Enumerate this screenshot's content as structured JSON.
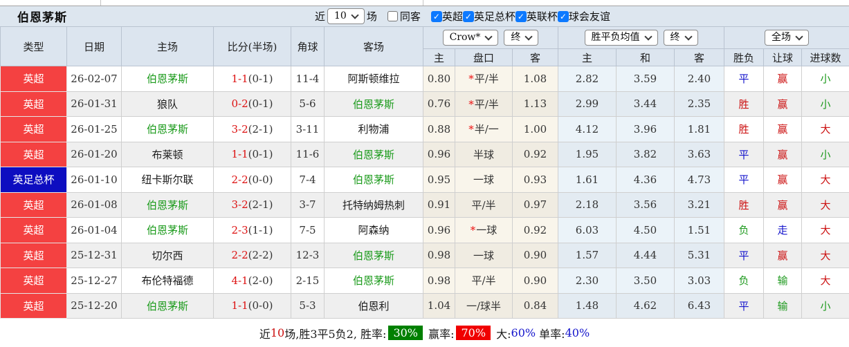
{
  "title": "伯恩茅斯",
  "filter_bar": {
    "recent_label": "近",
    "recent_select": "10",
    "matches_label": "场",
    "same_away_label": "同客",
    "leagues": [
      {
        "label": "英超",
        "checked": true
      },
      {
        "label": "英足总杯",
        "checked": true
      },
      {
        "label": "英联杯",
        "checked": true
      },
      {
        "label": "球会友谊",
        "checked": true
      }
    ]
  },
  "selectors": {
    "crow": "Crow*",
    "crow_state": "终",
    "avg": "胜平负均值",
    "avg_state": "终",
    "scope": "全场"
  },
  "columns": {
    "main": [
      "类型",
      "日期",
      "主场",
      "比分(半场)",
      "角球",
      "客场"
    ],
    "sub": [
      "主",
      "盘口",
      "客",
      "主",
      "和",
      "客",
      "胜负",
      "让球",
      "进球数"
    ]
  },
  "rows": [
    {
      "type": "英超",
      "type_color": "red",
      "date": "26-02-07",
      "home": "伯恩茅斯",
      "home_hl": true,
      "score": "1-1",
      "half": "(0-1)",
      "corner": "11-4",
      "away": "阿斯顿维拉",
      "away_hl": false,
      "crow_home": "0.80",
      "star": true,
      "handicap": "平/半",
      "crow_away": "1.08",
      "avg_home": "2.82",
      "avg_draw": "3.59",
      "avg_away": "2.40",
      "result": "平",
      "result_c": "blue",
      "let": "赢",
      "let_c": "red",
      "goal": "小",
      "goal_c": "green"
    },
    {
      "type": "英超",
      "type_color": "red",
      "date": "26-01-31",
      "home": "狼队",
      "home_hl": false,
      "score": "0-2",
      "half": "(0-1)",
      "corner": "5-6",
      "away": "伯恩茅斯",
      "away_hl": true,
      "crow_home": "0.76",
      "star": true,
      "handicap": "平/半",
      "crow_away": "1.13",
      "avg_home": "2.99",
      "avg_draw": "3.44",
      "avg_away": "2.35",
      "result": "胜",
      "result_c": "red",
      "let": "赢",
      "let_c": "red",
      "goal": "小",
      "goal_c": "green"
    },
    {
      "type": "英超",
      "type_color": "red",
      "date": "26-01-25",
      "home": "伯恩茅斯",
      "home_hl": true,
      "score": "3-2",
      "half": "(2-1)",
      "corner": "3-11",
      "away": "利物浦",
      "away_hl": false,
      "crow_home": "0.88",
      "star": true,
      "handicap": "半/一",
      "crow_away": "1.00",
      "avg_home": "4.12",
      "avg_draw": "3.96",
      "avg_away": "1.81",
      "result": "胜",
      "result_c": "red",
      "let": "赢",
      "let_c": "red",
      "goal": "大",
      "goal_c": "red"
    },
    {
      "type": "英超",
      "type_color": "red",
      "date": "26-01-20",
      "home": "布莱顿",
      "home_hl": false,
      "score": "1-1",
      "half": "(0-1)",
      "corner": "11-6",
      "away": "伯恩茅斯",
      "away_hl": true,
      "crow_home": "0.96",
      "star": false,
      "handicap": "半球",
      "crow_away": "0.92",
      "avg_home": "1.95",
      "avg_draw": "3.82",
      "avg_away": "3.63",
      "result": "平",
      "result_c": "blue",
      "let": "赢",
      "let_c": "red",
      "goal": "小",
      "goal_c": "green"
    },
    {
      "type": "英足总杯",
      "type_color": "blue",
      "date": "26-01-10",
      "home": "纽卡斯尔联",
      "home_hl": false,
      "score": "2-2",
      "half": "(0-0)",
      "corner": "7-4",
      "away": "伯恩茅斯",
      "away_hl": true,
      "crow_home": "0.95",
      "star": false,
      "handicap": "一球",
      "crow_away": "0.93",
      "avg_home": "1.61",
      "avg_draw": "4.36",
      "avg_away": "4.73",
      "result": "平",
      "result_c": "blue",
      "let": "赢",
      "let_c": "red",
      "goal": "大",
      "goal_c": "red"
    },
    {
      "type": "英超",
      "type_color": "red",
      "date": "26-01-08",
      "home": "伯恩茅斯",
      "home_hl": true,
      "score": "3-2",
      "half": "(2-1)",
      "corner": "3-7",
      "away": "托特纳姆热刺",
      "away_hl": false,
      "crow_home": "0.91",
      "star": false,
      "handicap": "平/半",
      "crow_away": "0.97",
      "avg_home": "2.18",
      "avg_draw": "3.56",
      "avg_away": "3.21",
      "result": "胜",
      "result_c": "red",
      "let": "赢",
      "let_c": "red",
      "goal": "大",
      "goal_c": "red"
    },
    {
      "type": "英超",
      "type_color": "red",
      "date": "26-01-04",
      "home": "伯恩茅斯",
      "home_hl": true,
      "score": "2-3",
      "half": "(1-1)",
      "corner": "7-5",
      "away": "阿森纳",
      "away_hl": false,
      "crow_home": "0.96",
      "star": true,
      "handicap": "一球",
      "crow_away": "0.92",
      "avg_home": "6.03",
      "avg_draw": "4.50",
      "avg_away": "1.51",
      "result": "负",
      "result_c": "green",
      "let": "走",
      "let_c": "blue",
      "goal": "大",
      "goal_c": "red"
    },
    {
      "type": "英超",
      "type_color": "red",
      "date": "25-12-31",
      "home": "切尔西",
      "home_hl": false,
      "score": "2-2",
      "half": "(2-2)",
      "corner": "12-3",
      "away": "伯恩茅斯",
      "away_hl": true,
      "crow_home": "0.98",
      "star": false,
      "handicap": "一球",
      "crow_away": "0.90",
      "avg_home": "1.57",
      "avg_draw": "4.44",
      "avg_away": "5.31",
      "result": "平",
      "result_c": "blue",
      "let": "赢",
      "let_c": "red",
      "goal": "大",
      "goal_c": "red"
    },
    {
      "type": "英超",
      "type_color": "red",
      "date": "25-12-27",
      "home": "布伦特福德",
      "home_hl": false,
      "score": "4-1",
      "half": "(2-0)",
      "corner": "2-15",
      "away": "伯恩茅斯",
      "away_hl": true,
      "crow_home": "0.98",
      "star": false,
      "handicap": "平/半",
      "crow_away": "0.90",
      "avg_home": "2.30",
      "avg_draw": "3.50",
      "avg_away": "3.03",
      "result": "负",
      "result_c": "green",
      "let": "输",
      "let_c": "green",
      "goal": "大",
      "goal_c": "red"
    },
    {
      "type": "英超",
      "type_color": "red",
      "date": "25-12-20",
      "home": "伯恩茅斯",
      "home_hl": true,
      "score": "1-1",
      "half": "(0-0)",
      "corner": "5-3",
      "away": "伯恩利",
      "away_hl": false,
      "crow_home": "1.04",
      "star": false,
      "handicap": "一/球半",
      "crow_away": "0.84",
      "avg_home": "1.48",
      "avg_draw": "4.62",
      "avg_away": "6.43",
      "result": "平",
      "result_c": "blue",
      "let": "输",
      "let_c": "green",
      "goal": "小",
      "goal_c": "green"
    }
  ],
  "footer": {
    "segments": [
      {
        "t": "近",
        "name": "footer-text"
      },
      {
        "t": "10",
        "c": "red",
        "name": "footer-recent-count"
      },
      {
        "t": "场,胜3平5负2, 胜率:",
        "name": "footer-text"
      },
      {
        "t": "30%",
        "c": "white",
        "bg": "#008000",
        "name": "footer-win-rate-badge"
      },
      {
        "t": " 赢率:",
        "name": "footer-text"
      },
      {
        "t": "70%",
        "c": "white",
        "bg": "#f00000",
        "name": "footer-handicap-rate-badge"
      },
      {
        "t": " 大:",
        "name": "footer-text"
      },
      {
        "t": "60%",
        "c": "blue",
        "name": "footer-over-rate"
      },
      {
        "t": " 单率:",
        "name": "footer-text"
      },
      {
        "t": "40%",
        "c": "blue",
        "name": "footer-odd-rate"
      }
    ]
  },
  "colors": {
    "text": {
      "red": "#cc1111",
      "blue": "#1414cc",
      "green": "#1e9a1e"
    },
    "score_red": "#dd1111",
    "type_bg": {
      "red": "#f44141",
      "blue": "#0d0dc0"
    },
    "checkbox_accent": "#0c79ff",
    "header_bg": "#dce5ef",
    "title_bar_bg": "#dde6ef",
    "footer_win_bg": "#008000",
    "footer_handicap_bg": "#f00000"
  }
}
